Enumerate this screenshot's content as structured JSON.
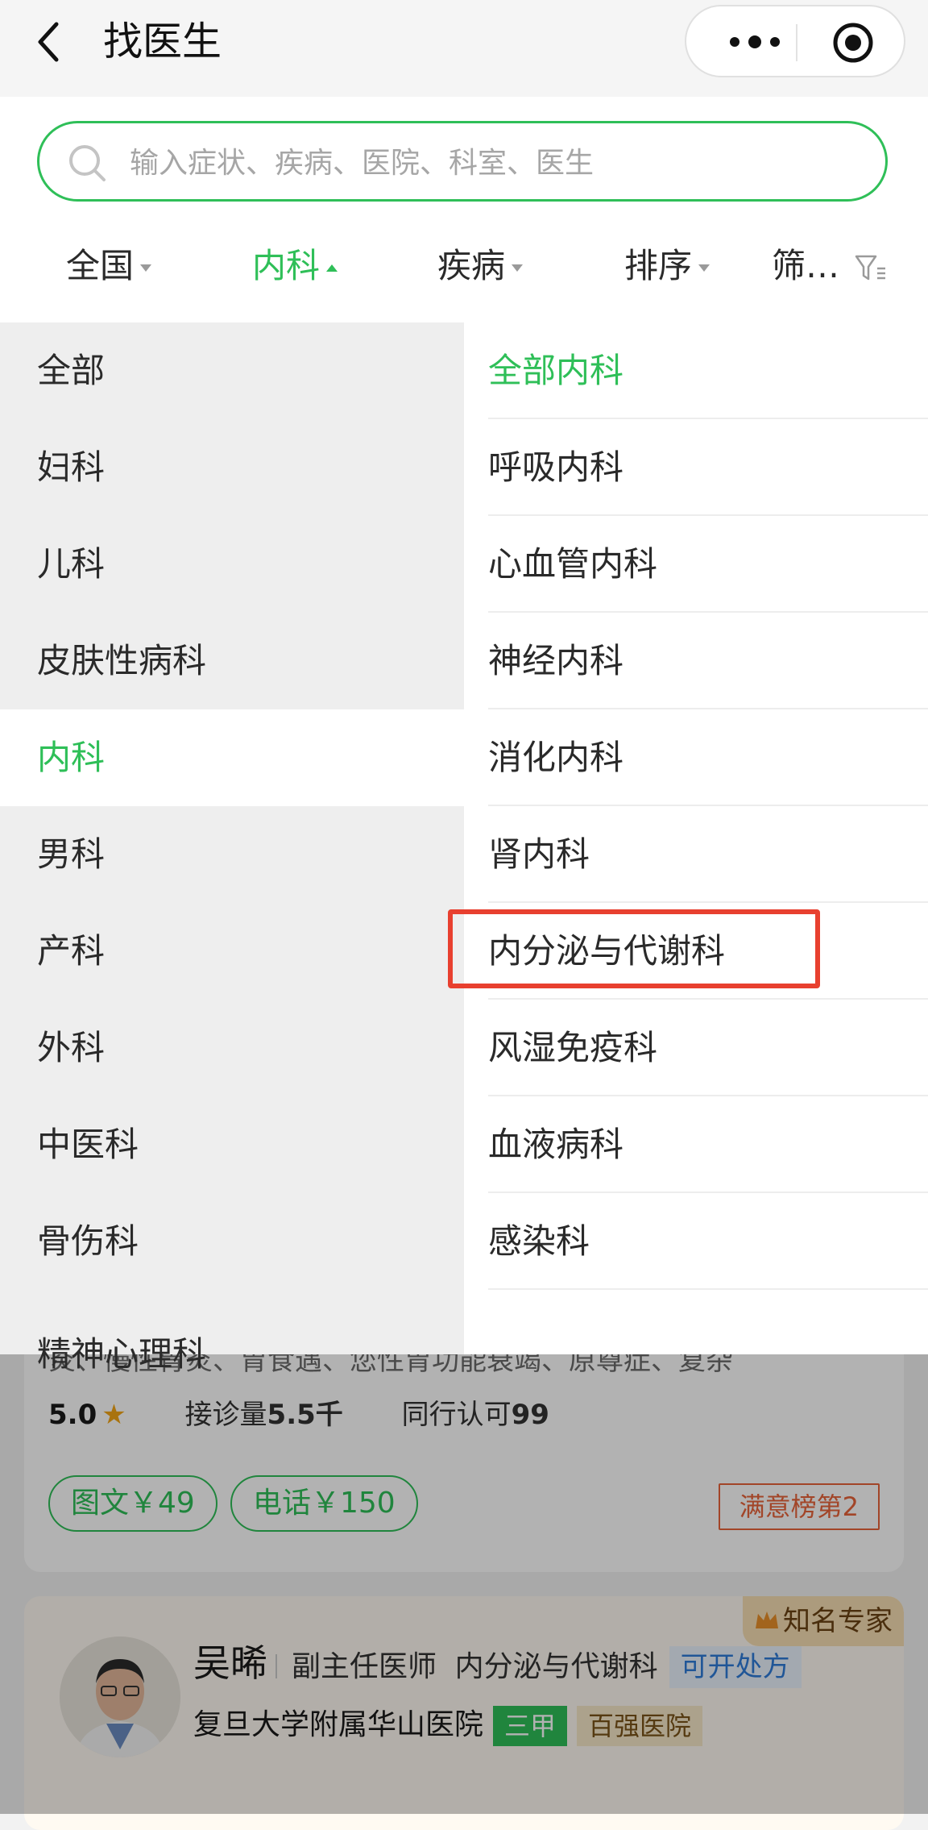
{
  "header": {
    "title": "找医生"
  },
  "search": {
    "placeholder": "输入症状、疾病、医院、科室、医生"
  },
  "filters": [
    {
      "label": "全国"
    },
    {
      "label": "内科"
    },
    {
      "label": "疾病"
    },
    {
      "label": "排序"
    },
    {
      "label": "筛…"
    }
  ],
  "departments": [
    {
      "label": "全部"
    },
    {
      "label": "妇科"
    },
    {
      "label": "儿科"
    },
    {
      "label": "皮肤性病科"
    },
    {
      "label": "内科"
    },
    {
      "label": "男科"
    },
    {
      "label": "产科"
    },
    {
      "label": "外科"
    },
    {
      "label": "中医科"
    },
    {
      "label": "骨伤科"
    },
    {
      "label": "精神心理科"
    }
  ],
  "subdepartments": [
    {
      "label": "全部内科"
    },
    {
      "label": "呼吸内科"
    },
    {
      "label": "心血管内科"
    },
    {
      "label": "神经内科"
    },
    {
      "label": "消化内科"
    },
    {
      "label": "肾内科"
    },
    {
      "label": "内分泌与代谢科"
    },
    {
      "label": "风湿免疫科"
    },
    {
      "label": "血液病科"
    },
    {
      "label": "感染科"
    }
  ],
  "doctor_card_1": {
    "clipped_text": "炎、慢性胃炎、胃食遇、您性胃功能衰竭、原尊症、复杂",
    "rating": "5.0",
    "consult_label": "接诊量",
    "consult_value": "5.5千",
    "peer_label": "同行认可",
    "peer_value": "99",
    "service_text": "图文￥49",
    "service_phone": "电话￥150",
    "rank_badge": "满意榜第2"
  },
  "doctor_card_2": {
    "ribbon": "知名专家",
    "name": "吴晞",
    "title": "副主任医师",
    "department": "内分泌与代谢科",
    "prescription": "可开处方",
    "hospital": "复旦大学附属华山医院",
    "tier": "三甲",
    "honor": "百强医院"
  },
  "colors": {
    "accent": "#2fbf58",
    "highlight": "#e8402f",
    "rank": "#e8643a",
    "rx": "#2f7bd8"
  },
  "icons": [
    "back-arrow-icon",
    "more-dots-icon",
    "target-icon",
    "search-icon",
    "filter-funnel-icon",
    "star-icon",
    "crown-icon"
  ]
}
